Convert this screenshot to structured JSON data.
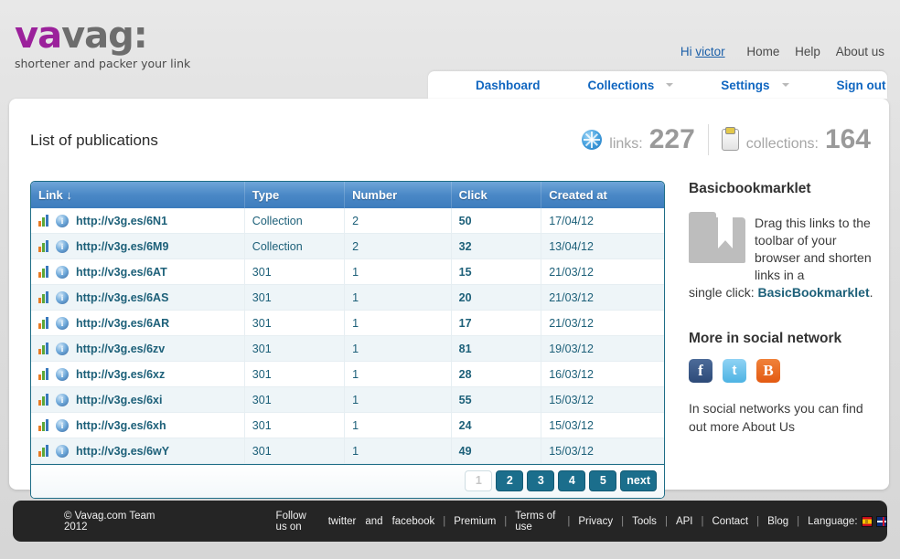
{
  "brand": {
    "logo_part1": "va",
    "logo_part2": "vag:",
    "tagline": "shortener and packer your link"
  },
  "topbar": {
    "greeting": "Hi",
    "username": "victor",
    "links": [
      "Home",
      "Help",
      "About us"
    ]
  },
  "nav": {
    "items": [
      {
        "label": "Dashboard",
        "has_caret": false
      },
      {
        "label": "Collections",
        "has_caret": true
      },
      {
        "label": "Settings",
        "has_caret": true
      },
      {
        "label": "Sign out",
        "has_caret": false
      }
    ]
  },
  "main": {
    "title": "List of publications",
    "stats": {
      "links_label": "links:",
      "links_value": "227",
      "collections_label": "collections:",
      "collections_value": "164"
    },
    "table": {
      "columns": [
        "Link",
        "Type",
        "Number",
        "Click",
        "Created at"
      ],
      "sort_indicator": "↓",
      "rows": [
        {
          "link": "http://v3g.es/6N1",
          "type": "Collection",
          "number": "2",
          "click": "50",
          "created": "17/04/12"
        },
        {
          "link": "http://v3g.es/6M9",
          "type": "Collection",
          "number": "2",
          "click": "32",
          "created": "13/04/12"
        },
        {
          "link": "http://v3g.es/6AT",
          "type": "301",
          "number": "1",
          "click": "15",
          "created": "21/03/12"
        },
        {
          "link": "http://v3g.es/6AS",
          "type": "301",
          "number": "1",
          "click": "20",
          "created": "21/03/12"
        },
        {
          "link": "http://v3g.es/6AR",
          "type": "301",
          "number": "1",
          "click": "17",
          "created": "21/03/12"
        },
        {
          "link": "http://v3g.es/6zv",
          "type": "301",
          "number": "1",
          "click": "81",
          "created": "19/03/12"
        },
        {
          "link": "http://v3g.es/6xz",
          "type": "301",
          "number": "1",
          "click": "28",
          "created": "16/03/12"
        },
        {
          "link": "http://v3g.es/6xi",
          "type": "301",
          "number": "1",
          "click": "55",
          "created": "15/03/12"
        },
        {
          "link": "http://v3g.es/6xh",
          "type": "301",
          "number": "1",
          "click": "24",
          "created": "15/03/12"
        },
        {
          "link": "http://v3g.es/6wY",
          "type": "301",
          "number": "1",
          "click": "49",
          "created": "15/03/12"
        }
      ]
    },
    "pagination": {
      "pages": [
        "1",
        "2",
        "3",
        "4",
        "5"
      ],
      "current": "1",
      "next_label": "next"
    }
  },
  "sidebar": {
    "bookmarklet_heading": "Basicbookmarklet",
    "bookmarklet_text": "Drag this links to the toolbar of your browser and shorten links in a",
    "bookmarklet_text2_prefix": "single click: ",
    "bookmarklet_link": "BasicBookmarklet",
    "bookmarklet_text2_suffix": ".",
    "social_heading": "More in social network",
    "social_icons": [
      {
        "name": "facebook",
        "glyph": "f"
      },
      {
        "name": "twitter",
        "glyph": "t"
      },
      {
        "name": "blogger",
        "glyph": "B"
      }
    ],
    "social_text": "In social networks you can find out more About Us"
  },
  "footer": {
    "copyright": "© Vavag.com Team 2012",
    "follow_prefix": "Follow us on",
    "follow_twitter": "twitter",
    "follow_and": "and",
    "follow_facebook": "facebook",
    "links": [
      "Premium",
      "Terms of use",
      "Privacy",
      "Tools",
      "API",
      "Contact",
      "Blog"
    ],
    "language_label": "Language:",
    "flags": [
      "es",
      "uk"
    ]
  },
  "colors": {
    "brand_purple": "#9b219b",
    "nav_blue": "#1066c0",
    "table_header_blue": "#4a88c6",
    "table_text_teal": "#1d6079",
    "footer_bg": "#252525"
  }
}
